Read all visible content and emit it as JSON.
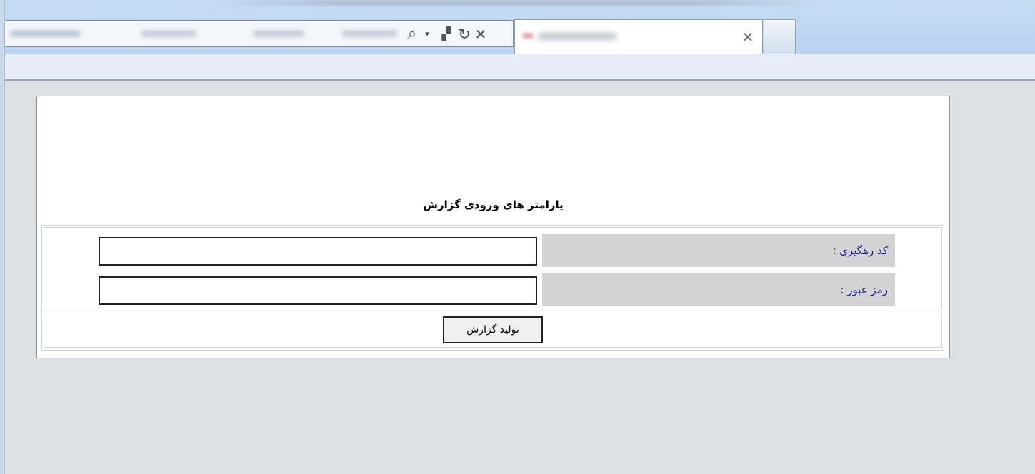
{
  "browser": {
    "icons": {
      "search": "search-icon",
      "dropdown": "chevron-down-icon",
      "compatibility": "compatibility-view-icon",
      "refresh": "refresh-icon",
      "stop": "close-icon",
      "tab_close": "close-icon"
    }
  },
  "form": {
    "heading": "پارامتر های ورودی گزارش",
    "fields": [
      {
        "label": "کد رهگیری :",
        "value": ""
      },
      {
        "label": "رمز عبور :",
        "value": ""
      }
    ],
    "submit_label": "تولید گزارش"
  },
  "colors": {
    "label_background": "#d3d3d3",
    "label_text": "#1a1a8c",
    "page_background": "#dfe0e6",
    "chrome_background": "#b9d4f1"
  }
}
